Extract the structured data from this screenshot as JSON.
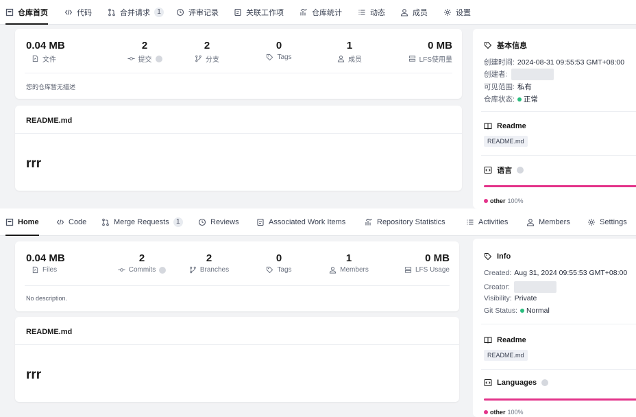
{
  "colors": {
    "status_green": "#2bbd7e",
    "language_bar": "#e3338a",
    "accent_dark": "#191919"
  },
  "zh": {
    "tabs": [
      {
        "label": "仓库首页",
        "icon": "repo-home-icon"
      },
      {
        "label": "代码",
        "icon": "code-icon"
      },
      {
        "label": "合并请求",
        "icon": "merge-request-icon",
        "badge": "1"
      },
      {
        "label": "评审记录",
        "icon": "review-icon"
      },
      {
        "label": "关联工作项",
        "icon": "work-item-icon"
      },
      {
        "label": "仓库统计",
        "icon": "statistics-icon"
      },
      {
        "label": "动态",
        "icon": "activity-icon"
      },
      {
        "label": "成员",
        "icon": "members-icon"
      },
      {
        "label": "设置",
        "icon": "settings-icon"
      }
    ],
    "stats": [
      {
        "value": "0.04 MB",
        "label": "文件",
        "icon": "file-icon"
      },
      {
        "value": "2",
        "label": "提交",
        "icon": "commit-icon"
      },
      {
        "value": "2",
        "label": "分支",
        "icon": "branch-icon"
      },
      {
        "value": "0",
        "label": "Tags",
        "icon": "tag-icon"
      },
      {
        "value": "1",
        "label": "成员",
        "icon": "member-icon"
      },
      {
        "value": "0 MB",
        "label": "LFS使用量",
        "icon": "lfs-icon"
      }
    ],
    "description": "您的仓库暂无描述",
    "readme": {
      "title": "README.md",
      "content": "rrr"
    },
    "info": {
      "title": "基本信息",
      "created_label": "创建时间:",
      "created_value": "2024-08-31 09:55:53 GMT+08:00",
      "creator_label": "创建者:",
      "visibility_label": "可见范围:",
      "visibility_value": "私有",
      "status_label": "仓库状态:",
      "status_value": "正常"
    },
    "readme_section": {
      "title": "Readme",
      "file": "README.md"
    },
    "languages": {
      "title": "语言",
      "items": [
        {
          "name": "other",
          "percent": "100%"
        }
      ]
    }
  },
  "en": {
    "tabs": [
      {
        "label": "Home",
        "icon": "repo-home-icon"
      },
      {
        "label": "Code",
        "icon": "code-icon"
      },
      {
        "label": "Merge Requests",
        "icon": "merge-request-icon",
        "badge": "1"
      },
      {
        "label": "Reviews",
        "icon": "review-icon"
      },
      {
        "label": "Associated Work Items",
        "icon": "work-item-icon"
      },
      {
        "label": "Repository Statistics",
        "icon": "statistics-icon"
      },
      {
        "label": "Activities",
        "icon": "activity-icon"
      },
      {
        "label": "Members",
        "icon": "members-icon"
      },
      {
        "label": "Settings",
        "icon": "settings-icon"
      }
    ],
    "stats": [
      {
        "value": "0.04 MB",
        "label": "Files",
        "icon": "file-icon"
      },
      {
        "value": "2",
        "label": "Commits",
        "icon": "commit-icon"
      },
      {
        "value": "2",
        "label": "Branches",
        "icon": "branch-icon"
      },
      {
        "value": "0",
        "label": "Tags",
        "icon": "tag-icon"
      },
      {
        "value": "1",
        "label": "Members",
        "icon": "member-icon"
      },
      {
        "value": "0 MB",
        "label": "LFS Usage",
        "icon": "lfs-icon"
      }
    ],
    "description": "No description.",
    "readme": {
      "title": "README.md",
      "content": "rrr"
    },
    "info": {
      "title": "Info",
      "created_label": "Created:",
      "created_value": "Aug 31, 2024 09:55:53 GMT+08:00",
      "creator_label": "Creator:",
      "visibility_label": "Visibility:",
      "visibility_value": "Private",
      "status_label": "Git Status:",
      "status_value": "Normal"
    },
    "readme_section": {
      "title": "Readme",
      "file": "README.md"
    },
    "languages": {
      "title": "Languages",
      "items": [
        {
          "name": "other",
          "percent": "100%"
        }
      ]
    }
  }
}
